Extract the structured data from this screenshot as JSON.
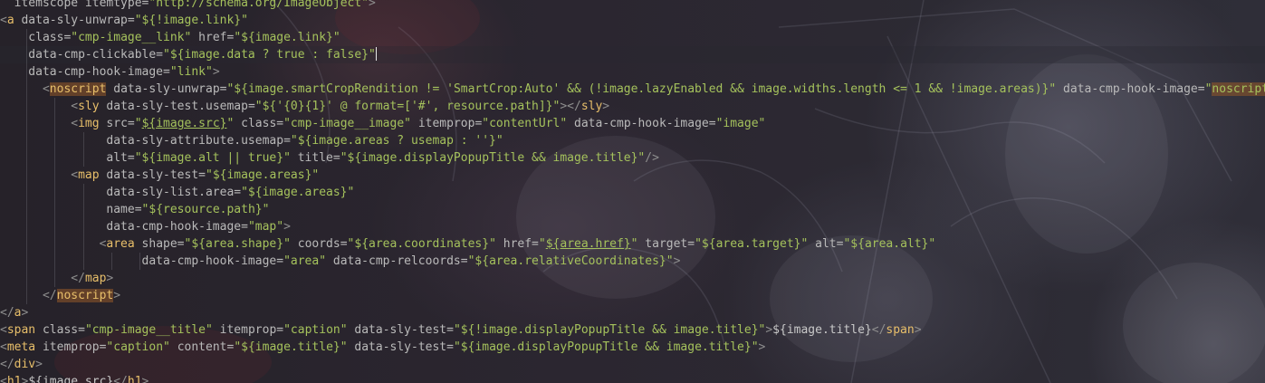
{
  "editor": {
    "language": "HTL",
    "cursor_line": 4,
    "lines": [
      [
        {
          "c": "a",
          "t": "  itemscope itemtype="
        },
        {
          "c": "s",
          "t": "\"http://schema.org/ImageObject\""
        },
        {
          "c": "br",
          "t": ">"
        }
      ],
      [
        {
          "c": "br",
          "t": "<"
        },
        {
          "c": "t",
          "t": "a"
        },
        {
          "c": "a",
          "t": " data-sly-unwrap="
        },
        {
          "c": "s",
          "t": "\"${!image.link}\""
        }
      ],
      [
        {
          "c": "a",
          "t": "    class="
        },
        {
          "c": "s",
          "t": "\"cmp-image__link\""
        },
        {
          "c": "a",
          "t": " href="
        },
        {
          "c": "s",
          "t": "\"${image.link}\""
        }
      ],
      [
        {
          "c": "a",
          "t": "    data-cmp-clickable="
        },
        {
          "c": "s",
          "t": "\"${image.data ? true : false}\""
        }
      ],
      [
        {
          "c": "a",
          "t": "    data-cmp-hook-image="
        },
        {
          "c": "s",
          "t": "\"link\""
        },
        {
          "c": "br",
          "t": ">"
        }
      ],
      [
        {
          "c": "p",
          "t": "      "
        },
        {
          "c": "br",
          "t": "<"
        },
        {
          "c": "t",
          "t": "noscript",
          "hl": true
        },
        {
          "c": "a",
          "t": " data-sly-unwrap="
        },
        {
          "c": "s",
          "t": "\"${image.smartCropRendition != 'SmartCrop:Auto' && (!image.lazyEnabled && image.widths.length <= 1 && !image.areas)}\""
        },
        {
          "c": "a",
          "t": " data-cmp-hook-image="
        },
        {
          "c": "s",
          "t": "\""
        },
        {
          "c": "s",
          "t": "noscript",
          "hl": true
        },
        {
          "c": "s",
          "t": "\""
        },
        {
          "c": "br",
          "t": ">"
        }
      ],
      [
        {
          "c": "p",
          "t": "          "
        },
        {
          "c": "br",
          "t": "<"
        },
        {
          "c": "t",
          "t": "sly"
        },
        {
          "c": "a",
          "t": " data-sly-test.usemap="
        },
        {
          "c": "s",
          "t": "\"${'{0}{1}' @ format=['#', resource.path]}\""
        },
        {
          "c": "br",
          "t": "></"
        },
        {
          "c": "t",
          "t": "sly"
        },
        {
          "c": "br",
          "t": ">"
        }
      ],
      [
        {
          "c": "p",
          "t": "          "
        },
        {
          "c": "br",
          "t": "<"
        },
        {
          "c": "t",
          "t": "img"
        },
        {
          "c": "a",
          "t": " src="
        },
        {
          "c": "s",
          "t": "\""
        },
        {
          "c": "s",
          "t": "${image.src}",
          "u": true
        },
        {
          "c": "s",
          "t": "\""
        },
        {
          "c": "a",
          "t": " class="
        },
        {
          "c": "s",
          "t": "\"cmp-image__image\""
        },
        {
          "c": "a",
          "t": " itemprop="
        },
        {
          "c": "s",
          "t": "\"contentUrl\""
        },
        {
          "c": "a",
          "t": " data-cmp-hook-image="
        },
        {
          "c": "s",
          "t": "\"image\""
        }
      ],
      [
        {
          "c": "a",
          "t": "               data-sly-attribute.usemap="
        },
        {
          "c": "s",
          "t": "\"${image.areas ? usemap : ''}\""
        }
      ],
      [
        {
          "c": "a",
          "t": "               alt="
        },
        {
          "c": "s",
          "t": "\"${image.alt || true}\""
        },
        {
          "c": "a",
          "t": " title="
        },
        {
          "c": "s",
          "t": "\"${image.displayPopupTitle && image.title}\""
        },
        {
          "c": "br",
          "t": "/>"
        }
      ],
      [
        {
          "c": "p",
          "t": "          "
        },
        {
          "c": "br",
          "t": "<"
        },
        {
          "c": "t",
          "t": "map"
        },
        {
          "c": "a",
          "t": " data-sly-test="
        },
        {
          "c": "s",
          "t": "\"${image.areas}\""
        }
      ],
      [
        {
          "c": "a",
          "t": "               data-sly-list.area="
        },
        {
          "c": "s",
          "t": "\"${image.areas}\""
        }
      ],
      [
        {
          "c": "a",
          "t": "               name="
        },
        {
          "c": "s",
          "t": "\"${resource.path}\""
        }
      ],
      [
        {
          "c": "a",
          "t": "               data-cmp-hook-image="
        },
        {
          "c": "s",
          "t": "\"map\""
        },
        {
          "c": "br",
          "t": ">"
        }
      ],
      [
        {
          "c": "p",
          "t": "              "
        },
        {
          "c": "br",
          "t": "<"
        },
        {
          "c": "t",
          "t": "area"
        },
        {
          "c": "a",
          "t": " shape="
        },
        {
          "c": "s",
          "t": "\"${area.shape}\""
        },
        {
          "c": "a",
          "t": " coords="
        },
        {
          "c": "s",
          "t": "\"${area.coordinates}\""
        },
        {
          "c": "a",
          "t": " href="
        },
        {
          "c": "s",
          "t": "\""
        },
        {
          "c": "s",
          "t": "${area.href}",
          "u": true
        },
        {
          "c": "s",
          "t": "\""
        },
        {
          "c": "a",
          "t": " target="
        },
        {
          "c": "s",
          "t": "\"${area.target}\""
        },
        {
          "c": "a",
          "t": " alt="
        },
        {
          "c": "s",
          "t": "\"${area.alt}\""
        }
      ],
      [
        {
          "c": "a",
          "t": "                    data-cmp-hook-image="
        },
        {
          "c": "s",
          "t": "\"area\""
        },
        {
          "c": "a",
          "t": " data-cmp-relcoords="
        },
        {
          "c": "s",
          "t": "\"${area.relativeCoordinates}\""
        },
        {
          "c": "br",
          "t": ">"
        }
      ],
      [
        {
          "c": "p",
          "t": "          "
        },
        {
          "c": "br",
          "t": "</"
        },
        {
          "c": "t",
          "t": "map"
        },
        {
          "c": "br",
          "t": ">"
        }
      ],
      [
        {
          "c": "p",
          "t": "      "
        },
        {
          "c": "br",
          "t": "</"
        },
        {
          "c": "t",
          "t": "noscript",
          "hl": true
        },
        {
          "c": "br",
          "t": ">"
        }
      ],
      [
        {
          "c": "br",
          "t": "</"
        },
        {
          "c": "t",
          "t": "a"
        },
        {
          "c": "br",
          "t": ">"
        }
      ],
      [
        {
          "c": "br",
          "t": "<"
        },
        {
          "c": "t",
          "t": "span"
        },
        {
          "c": "a",
          "t": " class="
        },
        {
          "c": "s",
          "t": "\"cmp-image__title\""
        },
        {
          "c": "a",
          "t": " itemprop="
        },
        {
          "c": "s",
          "t": "\"caption\""
        },
        {
          "c": "a",
          "t": " data-sly-test="
        },
        {
          "c": "s",
          "t": "\"${!image.displayPopupTitle && image.title}\""
        },
        {
          "c": "br",
          "t": ">"
        },
        {
          "c": "p",
          "t": "${image.title}"
        },
        {
          "c": "br",
          "t": "</"
        },
        {
          "c": "t",
          "t": "span"
        },
        {
          "c": "br",
          "t": ">"
        }
      ],
      [
        {
          "c": "br",
          "t": "<"
        },
        {
          "c": "t",
          "t": "meta"
        },
        {
          "c": "a",
          "t": " itemprop="
        },
        {
          "c": "s",
          "t": "\"caption\""
        },
        {
          "c": "a",
          "t": " content="
        },
        {
          "c": "s",
          "t": "\"${image.title}\""
        },
        {
          "c": "a",
          "t": " data-sly-test="
        },
        {
          "c": "s",
          "t": "\"${image.displayPopupTitle && image.title}\""
        },
        {
          "c": "br",
          "t": ">"
        }
      ],
      [
        {
          "c": "br",
          "t": "</"
        },
        {
          "c": "t",
          "t": "div"
        },
        {
          "c": "br",
          "t": ">"
        }
      ],
      [
        {
          "c": "br",
          "t": "<"
        },
        {
          "c": "t",
          "t": "h1"
        },
        {
          "c": "br",
          "t": ">"
        },
        {
          "c": "p",
          "t": "${image.src}"
        },
        {
          "c": "br",
          "t": "</"
        },
        {
          "c": "t",
          "t": "h1"
        },
        {
          "c": "br",
          "t": ">"
        }
      ]
    ]
  }
}
